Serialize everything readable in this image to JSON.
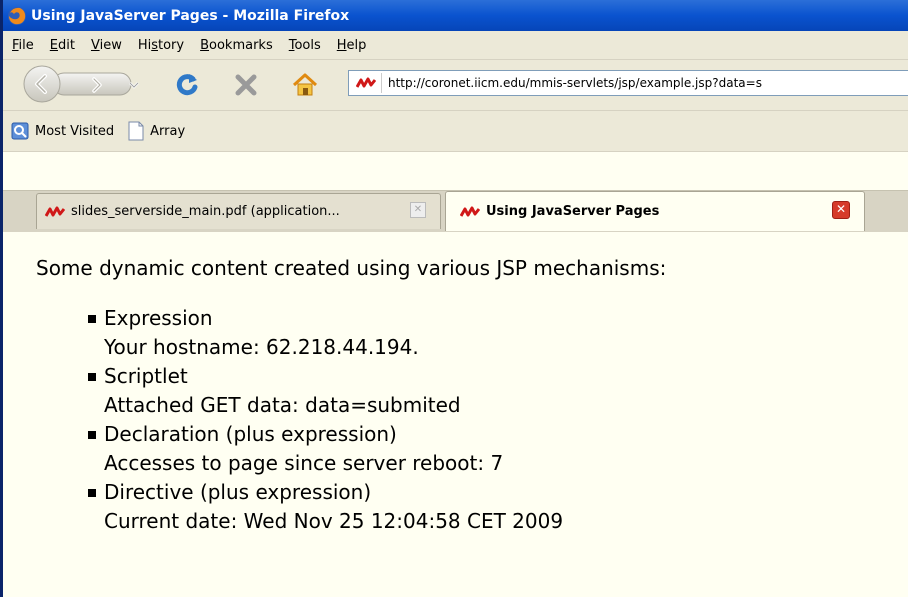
{
  "window": {
    "title": "Using JavaServer Pages - Mozilla Firefox"
  },
  "menubar": {
    "items": [
      {
        "label": "File",
        "ul": "F",
        "rest": "ile"
      },
      {
        "label": "Edit",
        "ul": "E",
        "rest": "dit"
      },
      {
        "label": "View",
        "ul": "V",
        "rest": "iew"
      },
      {
        "label": "History",
        "pre": "Hi",
        "ul": "s",
        "rest": "tory"
      },
      {
        "label": "Bookmarks",
        "ul": "B",
        "rest": "ookmarks"
      },
      {
        "label": "Tools",
        "ul": "T",
        "rest": "ools"
      },
      {
        "label": "Help",
        "ul": "H",
        "rest": "elp"
      }
    ]
  },
  "navbar": {
    "url": "http://coronet.iicm.edu/mmis-servlets/jsp/example.jsp?data=s"
  },
  "bookmarks": {
    "items": [
      {
        "label": "Most Visited",
        "icon": "most-visited-icon"
      },
      {
        "label": "Array",
        "icon": "page-icon"
      }
    ]
  },
  "tabs": [
    {
      "label": "slides_serverside_main.pdf (application...",
      "active": false
    },
    {
      "label": "Using JavaServer Pages",
      "active": true
    }
  ],
  "content": {
    "intro": "Some dynamic content created using various JSP mechanisms:",
    "items": [
      {
        "title": "Expression",
        "detail": "Your hostname: 62.218.44.194."
      },
      {
        "title": "Scriptlet",
        "detail": "Attached GET data: data=submited"
      },
      {
        "title": "Declaration (plus expression)",
        "detail": "Accesses to page since server reboot: 7"
      },
      {
        "title": "Directive (plus expression)",
        "detail": "Current date: Wed Nov 25 12:04:58 CET 2009"
      }
    ]
  },
  "colors": {
    "titlebar": "#0a53cf",
    "chrome": "#ece9d8",
    "content_bg": "#fffff2",
    "close_active": "#d63b2a",
    "reload": "#2f79c8",
    "stop": "#9a9a9a",
    "home": "#e8a317"
  }
}
